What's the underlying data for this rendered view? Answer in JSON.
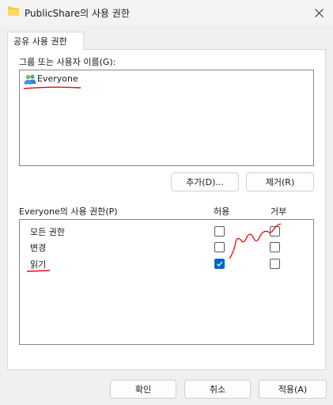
{
  "window": {
    "title": "PublicShare의 사용 권한",
    "close_icon": "close-icon",
    "folder_icon": "folder-icon"
  },
  "tab": {
    "label": "공유 사용 권한"
  },
  "group": {
    "label": "그룹 또는 사용자 이름(G):",
    "users": [
      {
        "name": "Everyone",
        "icon": "users-icon"
      }
    ],
    "add_label": "추가(D)...",
    "remove_label": "제거(R)"
  },
  "permissions": {
    "label": "Everyone의 사용 권한(P)",
    "allow_header": "허용",
    "deny_header": "거부",
    "rows": [
      {
        "label": "모든 권한",
        "allow": false,
        "deny": false
      },
      {
        "label": "변경",
        "allow": false,
        "deny": false
      },
      {
        "label": "읽기",
        "allow": true,
        "deny": false
      }
    ]
  },
  "footer": {
    "ok_label": "확인",
    "cancel_label": "취소",
    "apply_label": "적용(A)"
  },
  "colors": {
    "accent": "#0067c0",
    "annotation": "#e01010"
  }
}
